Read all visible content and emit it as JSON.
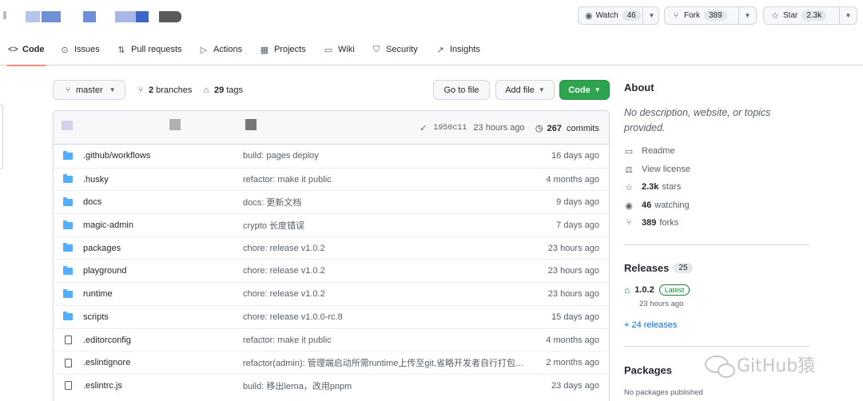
{
  "header": {
    "watch": {
      "label": "Watch",
      "count": "46"
    },
    "fork": {
      "label": "Fork",
      "count": "389"
    },
    "star": {
      "label": "Star",
      "count": "2.3k"
    }
  },
  "nav": {
    "tabs": [
      {
        "label": "Code",
        "icon": "code-icon",
        "active": true
      },
      {
        "label": "Issues",
        "icon": "issue-icon"
      },
      {
        "label": "Pull requests",
        "icon": "pull-request-icon"
      },
      {
        "label": "Actions",
        "icon": "play-icon"
      },
      {
        "label": "Projects",
        "icon": "table-icon"
      },
      {
        "label": "Wiki",
        "icon": "book-icon"
      },
      {
        "label": "Security",
        "icon": "shield-icon"
      },
      {
        "label": "Insights",
        "icon": "graph-icon"
      }
    ]
  },
  "controls": {
    "branch": "master",
    "branches_count": "2",
    "branches_label": "branches",
    "tags_count": "29",
    "tags_label": "tags",
    "go_to_file": "Go to file",
    "add_file": "Add file",
    "code": "Code"
  },
  "commit": {
    "sha": "1950c11",
    "time": "23 hours ago",
    "count": "267",
    "count_label": "commits"
  },
  "files": [
    {
      "type": "dir",
      "name": ".github/workflows",
      "message": "build: pages deploy",
      "age": "16 days ago"
    },
    {
      "type": "dir",
      "name": ".husky",
      "message": "refactor: make it public",
      "age": "4 months ago"
    },
    {
      "type": "dir",
      "name": "docs",
      "message": "docs: 更新文档",
      "age": "9 days ago"
    },
    {
      "type": "dir",
      "name": "magic-admin",
      "message": "crypto 长度错误",
      "age": "7 days ago"
    },
    {
      "type": "dir",
      "name": "packages",
      "message": "chore: release v1.0.2",
      "age": "23 hours ago"
    },
    {
      "type": "dir",
      "name": "playground",
      "message": "chore: release v1.0.2",
      "age": "23 hours ago"
    },
    {
      "type": "dir",
      "name": "runtime",
      "message": "chore: release v1.0.2",
      "age": "23 hours ago"
    },
    {
      "type": "dir",
      "name": "scripts",
      "message": "chore: release v1.0.0-rc.8",
      "age": "15 days ago"
    },
    {
      "type": "file",
      "name": ".editorconfig",
      "message": "refactor: make it public",
      "age": "4 months ago"
    },
    {
      "type": "file",
      "name": ".eslintignore",
      "message": "refactor(admin): 管理端启动所需runtime上传至git,省略开发者自行打包…",
      "age": "2 months ago"
    },
    {
      "type": "file",
      "name": ".eslintrc.js",
      "message": "build: 移出lerna，改用pnpm",
      "age": "23 days ago"
    }
  ],
  "about": {
    "title": "About",
    "description": "No description, website, or topics provided.",
    "readme": "Readme",
    "license": "View license",
    "stars_count": "2.3k",
    "stars_label": "stars",
    "watching_count": "46",
    "watching_label": "watching",
    "forks_count": "389",
    "forks_label": "forks"
  },
  "releases": {
    "title": "Releases",
    "count": "25",
    "latest_version": "1.0.2",
    "latest_badge": "Latest",
    "latest_date": "23 hours ago",
    "more": "+ 24 releases"
  },
  "packages": {
    "title": "Packages",
    "empty": "No packages published"
  },
  "watermark": "GitHub猿",
  "colors": {
    "accent": "#2da44e",
    "link": "#0969da",
    "folder": "#54aeff",
    "tab_underline": "#fd8c73"
  }
}
